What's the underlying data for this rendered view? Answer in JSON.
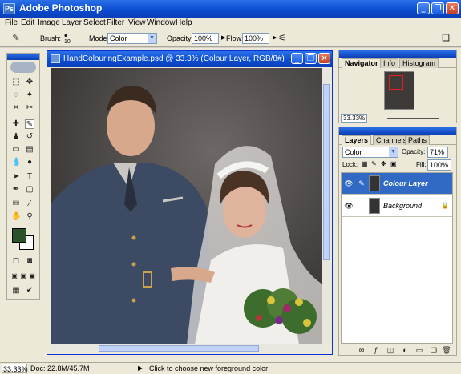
{
  "app": {
    "title": "Adobe Photoshop",
    "icon_label": "Ps"
  },
  "window_buttons": {
    "minimize": "_",
    "restore": "❐",
    "close": "✕"
  },
  "menu": [
    "File",
    "Edit",
    "Image",
    "Layer",
    "Select",
    "Filter",
    "View",
    "Window",
    "Help"
  ],
  "options": {
    "brush_label": "Brush:",
    "brush_size": "10",
    "mode_label": "Mode:",
    "mode_value": "Color",
    "opacity_label": "Opacity:",
    "opacity_value": "100%",
    "flow_label": "Flow:",
    "flow_value": "100%"
  },
  "document": {
    "title": "HandColouringExample.psd @ 33.3% (Colour Layer, RGB/8#)",
    "zoom": "33.33%"
  },
  "navigator": {
    "tabs": [
      "Navigator",
      "Info",
      "Histogram"
    ],
    "zoom": "33.33%"
  },
  "layers": {
    "tabs": [
      "Layers",
      "Channels",
      "Paths"
    ],
    "blend_mode": "Color",
    "opacity_label": "Opacity:",
    "opacity_value": "71%",
    "lock_label": "Lock:",
    "fill_label": "Fill:",
    "fill_value": "100%",
    "items": [
      {
        "name": "Colour Layer",
        "selected": true
      },
      {
        "name": "Background",
        "selected": false
      }
    ]
  },
  "status": {
    "zoom": "33.33%",
    "doc": "Doc: 22.8M/45.7M",
    "hint": "Click to choose new foreground color"
  },
  "colors": {
    "foreground": "#2b5228",
    "background": "#ffffff",
    "accent": "#0a4bd0",
    "selection": "#316ac5"
  }
}
